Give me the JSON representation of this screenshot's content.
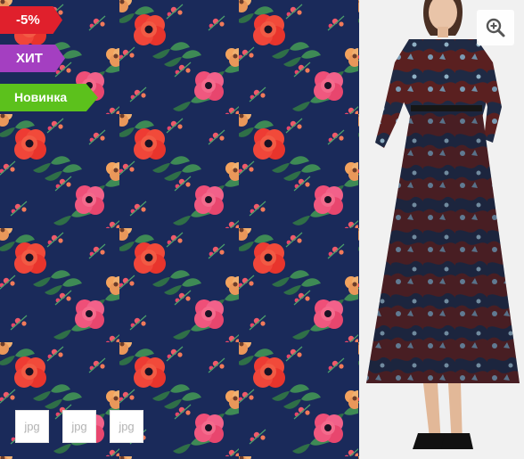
{
  "badges": {
    "sale": "-5%",
    "hit": "ХИТ",
    "new": "Новинка"
  },
  "zoom": {
    "icon": "zoom-in-icon"
  },
  "thumbnails": [
    {
      "label": "jpg"
    },
    {
      "label": "jpg"
    },
    {
      "label": "jpg"
    }
  ],
  "colors": {
    "fabric_background": "#1a2a5a",
    "sale_badge": "#e0202c",
    "hit_badge": "#a43fc1",
    "new_badge": "#5cc11c"
  }
}
